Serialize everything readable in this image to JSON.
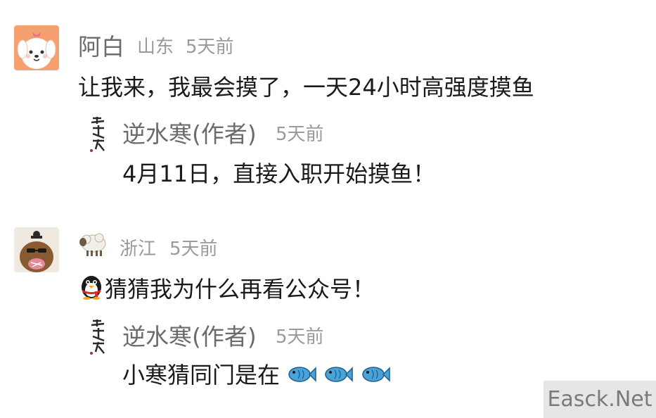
{
  "comments": [
    {
      "author": "阿白",
      "location": "山东",
      "time": "5天前",
      "text": "让我来，我最会摸了，一天24小时高强度摸鱼",
      "avatar_icon": "puppy-avatar-icon",
      "reply": {
        "author": "逆水寒(作者)",
        "time": "5天前",
        "text": "4月11日，直接入职开始摸鱼！",
        "avatar_icon": "calligraphy-avatar-icon"
      }
    },
    {
      "author_icon": "sheep-emoji-icon",
      "location": "浙江",
      "time": "5天前",
      "text": "猜猜我为什么再看公众号！",
      "avatar_icon": "capybara-avatar-icon",
      "prefix_icon": "qq-penguin-icon",
      "reply": {
        "author": "逆水寒(作者)",
        "time": "5天前",
        "text": "小寒猜同门是在",
        "avatar_icon": "calligraphy-avatar-icon",
        "suffix_icons": [
          "fish-icon",
          "fish-icon",
          "fish-icon"
        ]
      }
    }
  ],
  "watermark": "Easck.Net",
  "colors": {
    "name": "#6b6b6b",
    "meta": "#9a9a9a",
    "text": "#1a1a1a",
    "puppy_bg": "#f4a070"
  }
}
